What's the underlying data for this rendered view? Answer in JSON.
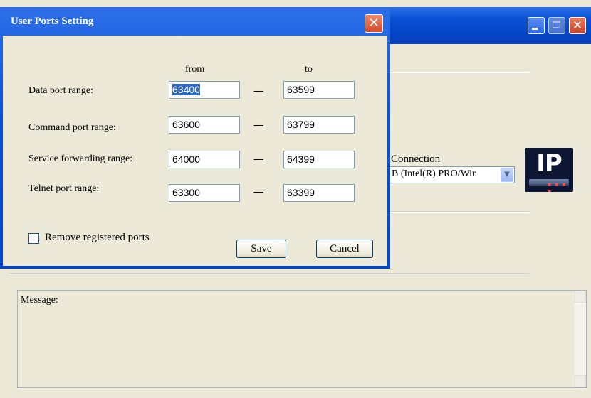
{
  "dialog": {
    "title": "User Ports Setting",
    "close_glyph": "✕",
    "col_from": "from",
    "col_to": "to",
    "separator": "----",
    "rows": [
      {
        "label": "Data port range:",
        "from": "63400",
        "to": "63599"
      },
      {
        "label": "Command port range:",
        "from": "63600",
        "to": "63799"
      },
      {
        "label": "Service forwarding range:",
        "from": "64000",
        "to": "64399"
      },
      {
        "label": "Telnet port range:",
        "from": "63300",
        "to": "63399"
      }
    ],
    "remove_registered_label": "Remove registered ports",
    "remove_registered_checked": false,
    "save_label": "Save",
    "cancel_label": "Cancel"
  },
  "main": {
    "connection_label": "Connection",
    "adapter_value": "B  (Intel(R) PRO/Win",
    "message_label": "Message:",
    "close_glyph": "✕",
    "dropdown_glyph": "▼",
    "logo_text": "IP"
  },
  "colors": {
    "titlebar_blue": "#0a52d6",
    "window_face": "#ece9d8",
    "close_red": "#d5492b",
    "selection": "#316ac5"
  },
  "icons": [
    "dropdown-arrow-icon",
    "ip-logo-icon",
    "close-icon",
    "minimize-icon",
    "maximize-icon",
    "scroll-up-icon",
    "scroll-down-icon"
  ]
}
